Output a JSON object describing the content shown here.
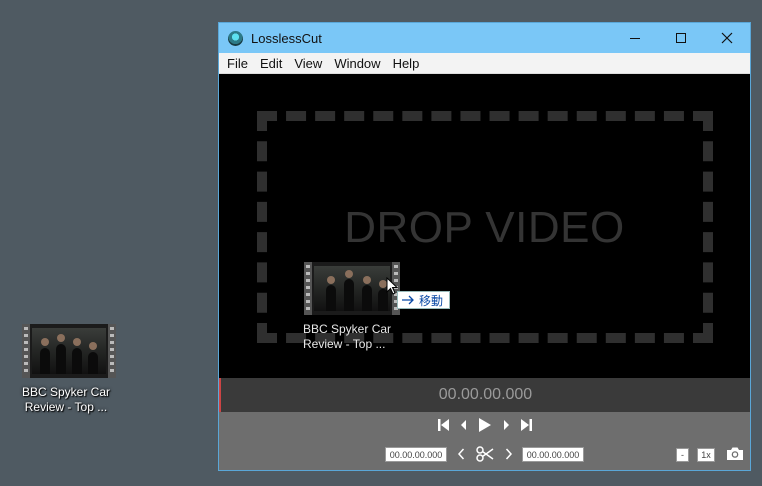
{
  "desktop": {
    "icon_label": "BBC  Spyker Car Review - Top ..."
  },
  "window": {
    "title": "LosslessCut",
    "menu": [
      "File",
      "Edit",
      "View",
      "Window",
      "Help"
    ]
  },
  "drop": {
    "prompt": "DROP VIDEO",
    "drag_label": "BBC  Spyker Car Review - Top ...",
    "tooltip": "移動"
  },
  "player": {
    "timecode": "00.00.00.000",
    "cut_start": "00.00.00.000",
    "cut_end": "00.00.00.000",
    "minus_label": "-",
    "rate_label": "1x"
  },
  "colors": {
    "titlebar": "#7ac7f7",
    "desktop": "#4f5a62",
    "controls": "#6e6e6e"
  }
}
